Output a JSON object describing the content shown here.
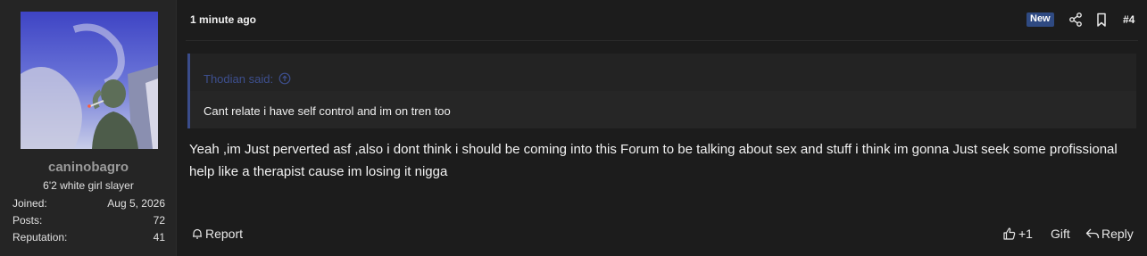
{
  "user": {
    "username": "caninobagro",
    "title": "6'2 white girl slayer",
    "stats": [
      {
        "label": "Joined:",
        "value": "Aug 5, 2026"
      },
      {
        "label": "Posts:",
        "value": "72"
      },
      {
        "label": "Reputation:",
        "value": "41"
      }
    ]
  },
  "post": {
    "time": "1 minute ago",
    "badge": "New",
    "number": "#4",
    "quote": {
      "author_line": "Thodian said:",
      "text": "Cant relate i have self control and im on tren too"
    },
    "message": "Yeah ,im Just perverted asf ,also i dont think i should be coming into this Forum to be talking about sex and stuff i think im gonna Just seek some profissional help like a therapist cause im losing it nigga"
  },
  "actions": {
    "report": "Report",
    "like_count": "+1",
    "gift": "Gift",
    "reply": "Reply"
  },
  "icons": {
    "share": "share-icon",
    "bookmark": "bookmark-icon",
    "quote_jump": "arrow-up-circle-icon",
    "report": "bell-icon",
    "like": "thumbs-up-icon",
    "reply": "reply-arrow-icon"
  },
  "colors": {
    "background": "#1c1c1c",
    "sidebar": "#252525",
    "badge": "#2f4a82",
    "quote_accent": "#3a4c8a"
  }
}
